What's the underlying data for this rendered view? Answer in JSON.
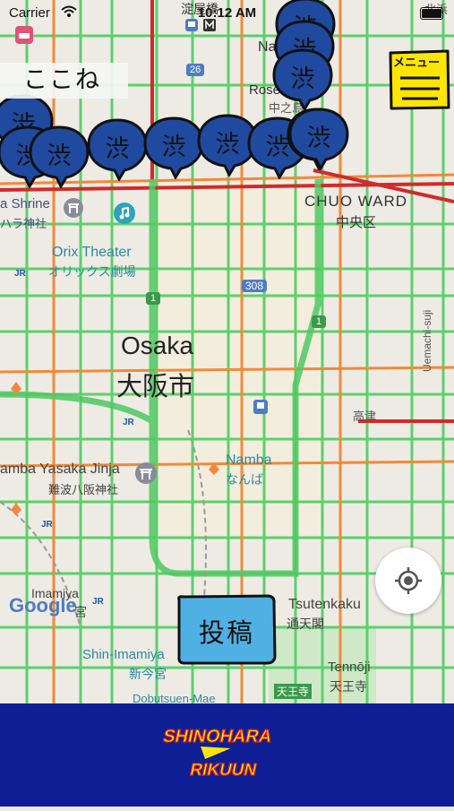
{
  "status_bar": {
    "carrier": "Carrier",
    "time": "10:12 AM"
  },
  "here_label": "ここね",
  "menu_button": {
    "label": "メニュー"
  },
  "post_button": {
    "label": "投稿"
  },
  "map": {
    "labels": {
      "yodoyabashi": "淀屋橋",
      "nakanoshima": "Na",
      "rose": "Rose",
      "nakanoshima_jp": "中之島",
      "kitahama": "北浜",
      "chuo_ward": "CHUO WARD",
      "chuo_ward_jp": "中央区",
      "shrine": "a Shrine",
      "shrine_jp": "ハラ神社",
      "orix": "Orix Theater",
      "orix_jp": "オリックス劇場",
      "route_308": "308",
      "route_1a": "1",
      "route_1b": "1",
      "route_26": "26",
      "osaka": "Osaka",
      "osaka_jp": "大阪市",
      "uemachi": "Uemachi-suji",
      "takatsu": "高津",
      "namba": "Namba",
      "namba_jp": "なんば",
      "yasaka": "amba Yasaka Jinja",
      "yasaka_jp": "難波八阪神社",
      "imamiya": "Imamiya",
      "imamiya_jp": "宮",
      "tsutenkaku": "Tsutenkaku",
      "tsutenkaku_jp": "通天閣",
      "shin_imamiya": "Shin-Imamiya",
      "shin_imamiya_jp": "新今宮",
      "tennoji": "Tennōji",
      "tennoji_jp": "天王寺",
      "tennoji_station": "天王寺",
      "dobutsuen": "Dobutsuen-Mae",
      "google": "Google",
      "jr1": "JR",
      "jr2": "JR",
      "jr3": "JR",
      "jr4": "JR"
    },
    "pins": [
      {
        "char": "渋"
      },
      {
        "char": "渋"
      },
      {
        "char": "渋"
      },
      {
        "char": "渋"
      },
      {
        "char": "渋"
      },
      {
        "char": "渋"
      },
      {
        "char": "渋"
      },
      {
        "char": "渋"
      },
      {
        "char": "渋"
      },
      {
        "char": "渋"
      },
      {
        "char": "渋"
      },
      {
        "char": "渋"
      }
    ]
  },
  "footer": {
    "logo_line1": "SHINOHARA",
    "logo_line2": "RIKUUN"
  },
  "colors": {
    "footer_bg": "#0e1f96",
    "pin_fill": "#1f4aa0",
    "menu_bg": "#ffe600",
    "post_bg": "#4fb1e3",
    "logo_yellow": "#ffe600",
    "logo_red": "#e0211e"
  }
}
